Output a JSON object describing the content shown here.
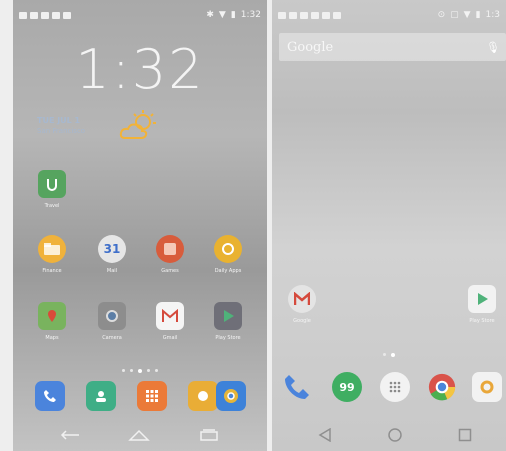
{
  "left_phone": {
    "status_time": "1:32",
    "clock_time": "1:32",
    "date": "TUE JUL 1",
    "location": "San Francisco",
    "apps_row1": [
      {
        "label": "Travel",
        "icon": "travel-app-icon",
        "color": "#56a45f"
      }
    ],
    "apps_row2": [
      {
        "label": "Finance",
        "icon": "folder-icon",
        "color": "#f0b23b"
      },
      {
        "label": "Mail",
        "icon": "calendar-icon",
        "color": "#4f7fd9"
      },
      {
        "label": "Games",
        "icon": "games-icon",
        "color": "#d85c3c"
      },
      {
        "label": "Daily Apps",
        "icon": "daily-apps-icon",
        "color": "#e9b230"
      }
    ],
    "apps_row3": [
      {
        "label": "Maps",
        "icon": "maps-icon",
        "color": "#79b35e"
      },
      {
        "label": "Camera",
        "icon": "camera-icon",
        "color": "#8d8d8d"
      },
      {
        "label": "Gmail",
        "icon": "gmail-icon",
        "color": "#f5f5f5"
      },
      {
        "label": "Play Store",
        "icon": "play-store-icon",
        "color": "#6f6f78"
      }
    ],
    "calendar_day": "31",
    "dock": [
      {
        "icon": "phone-icon",
        "color": "#4b84dc"
      },
      {
        "icon": "contacts-icon",
        "color": "#3fae86"
      },
      {
        "icon": "app-drawer-icon",
        "color": "#eb7a38"
      },
      {
        "icon": "messaging-icon",
        "color": "#e9ad36"
      },
      {
        "icon": "chrome-icon",
        "color": "#3d82d9"
      }
    ]
  },
  "right_phone": {
    "status_time": "1:3",
    "search_label": "Google",
    "apps": [
      {
        "label": "Google",
        "icon": "gmail-icon"
      },
      {
        "label": "Play Store",
        "icon": "play-store-icon"
      }
    ],
    "hangouts_glyph": "99",
    "dock": [
      {
        "icon": "phone-icon"
      },
      {
        "icon": "hangouts-icon"
      },
      {
        "icon": "app-drawer-icon"
      },
      {
        "icon": "chrome-icon"
      },
      {
        "icon": "photos-icon"
      }
    ]
  }
}
